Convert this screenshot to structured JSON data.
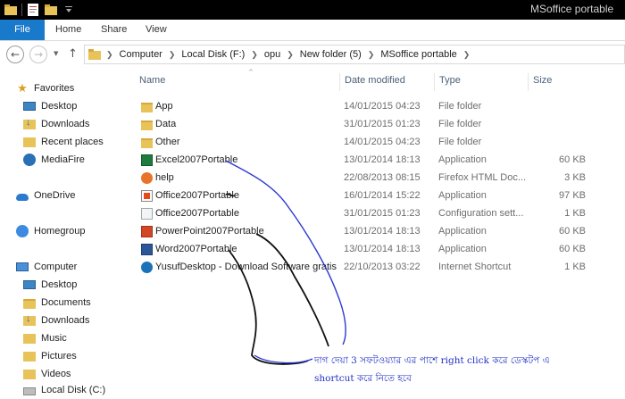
{
  "window": {
    "title": "MSoffice portable"
  },
  "ribbon": {
    "tabs": [
      "File",
      "Home",
      "Share",
      "View"
    ]
  },
  "address": {
    "crumbs": [
      "Computer",
      "Local Disk (F:)",
      "opu",
      "New folder (5)",
      "MSoffice portable"
    ]
  },
  "columns": {
    "name": "Name",
    "date": "Date modified",
    "type": "Type",
    "size": "Size"
  },
  "nav": {
    "favorites": "Favorites",
    "desktop": "Desktop",
    "downloads": "Downloads",
    "recent": "Recent places",
    "mediafire": "MediaFire",
    "onedrive": "OneDrive",
    "homegroup": "Homegroup",
    "computer": "Computer",
    "c_desktop": "Desktop",
    "c_documents": "Documents",
    "c_downloads": "Downloads",
    "c_music": "Music",
    "c_pictures": "Pictures",
    "c_videos": "Videos",
    "c_disk": "Local Disk (C:)"
  },
  "files": [
    {
      "name": "App",
      "date": "14/01/2015 04:23",
      "type": "File folder",
      "size": "",
      "icon": "folder-icon"
    },
    {
      "name": "Data",
      "date": "31/01/2015 01:23",
      "type": "File folder",
      "size": "",
      "icon": "folder-icon"
    },
    {
      "name": "Other",
      "date": "14/01/2015 04:23",
      "type": "File folder",
      "size": "",
      "icon": "folder-icon"
    },
    {
      "name": "Excel2007Portable",
      "date": "13/01/2014 18:13",
      "type": "Application",
      "size": "60 KB",
      "icon": "excel-icon"
    },
    {
      "name": "help",
      "date": "22/08/2013 08:15",
      "type": "Firefox HTML Doc...",
      "size": "3 KB",
      "icon": "firefox-html-icon"
    },
    {
      "name": "Office2007Portable",
      "date": "16/01/2014 15:22",
      "type": "Application",
      "size": "97 KB",
      "icon": "office-icon"
    },
    {
      "name": "Office2007Portable",
      "date": "31/01/2015 01:23",
      "type": "Configuration sett...",
      "size": "1 KB",
      "icon": "config-icon"
    },
    {
      "name": "PowerPoint2007Portable",
      "date": "13/01/2014 18:13",
      "type": "Application",
      "size": "60 KB",
      "icon": "powerpoint-icon"
    },
    {
      "name": "Word2007Portable",
      "date": "13/01/2014 18:13",
      "type": "Application",
      "size": "60 KB",
      "icon": "word-icon"
    },
    {
      "name": "YusufDesktop - Download Software gratis",
      "date": "22/10/2013 03:22",
      "type": "Internet Shortcut",
      "size": "1 KB",
      "icon": "internet-shortcut-icon"
    }
  ],
  "annotation": {
    "line1": "দাগ দেয়া  3 সফটওয়্যার এর পাশে right click করে ডেস্কটপ এ",
    "line2": "shortcut করে নিতে হবে",
    "color": "#2031c8"
  }
}
